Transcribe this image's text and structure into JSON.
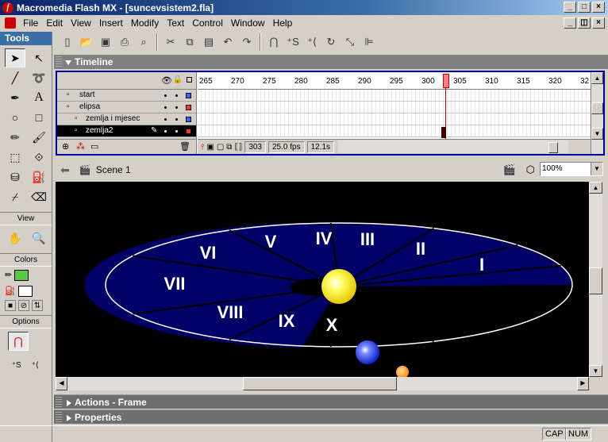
{
  "window": {
    "title": "Macromedia Flash MX - [suncevsistem2.fla]"
  },
  "menu": [
    "File",
    "Edit",
    "View",
    "Insert",
    "Modify",
    "Text",
    "Control",
    "Window",
    "Help"
  ],
  "tools_panel": {
    "title": "Tools",
    "view_label": "View",
    "colors_label": "Colors",
    "options_label": "Options",
    "stroke_color": "#000000",
    "fill_color": "#55cc44"
  },
  "timeline": {
    "title": "Timeline",
    "layers": [
      {
        "name": "start",
        "indent": false,
        "color": "#3366ff",
        "active": false
      },
      {
        "name": "elipsa",
        "indent": false,
        "color": "#ff3333",
        "active": false
      },
      {
        "name": "zemlja i mjesec",
        "indent": true,
        "color": "#3366ff",
        "active": false
      },
      {
        "name": "zemlja2",
        "indent": true,
        "color": "#ff3333",
        "active": true
      }
    ],
    "ruler_ticks": [
      "265",
      "270",
      "275",
      "280",
      "285",
      "290",
      "295",
      "300",
      "305",
      "310",
      "315",
      "320",
      "32"
    ],
    "current_frame": "303",
    "frame_rate": "25.0 fps",
    "elapsed": "12.1s"
  },
  "scene_bar": {
    "scene_name": "Scene 1",
    "zoom": "100%"
  },
  "stage": {
    "background": "#000000",
    "orbit_fill": "#000066",
    "sectors": [
      "I",
      "II",
      "III",
      "IV",
      "V",
      "VI",
      "VII",
      "VIII",
      "IX",
      "X"
    ],
    "sun_color": "#ffee33",
    "earth_color": "#4455ff",
    "moon_color": "#ff9922"
  },
  "panels": {
    "actions": "Actions - Frame",
    "properties": "Properties"
  },
  "statusbar": {
    "cap": "CAP",
    "num": "NUM"
  }
}
